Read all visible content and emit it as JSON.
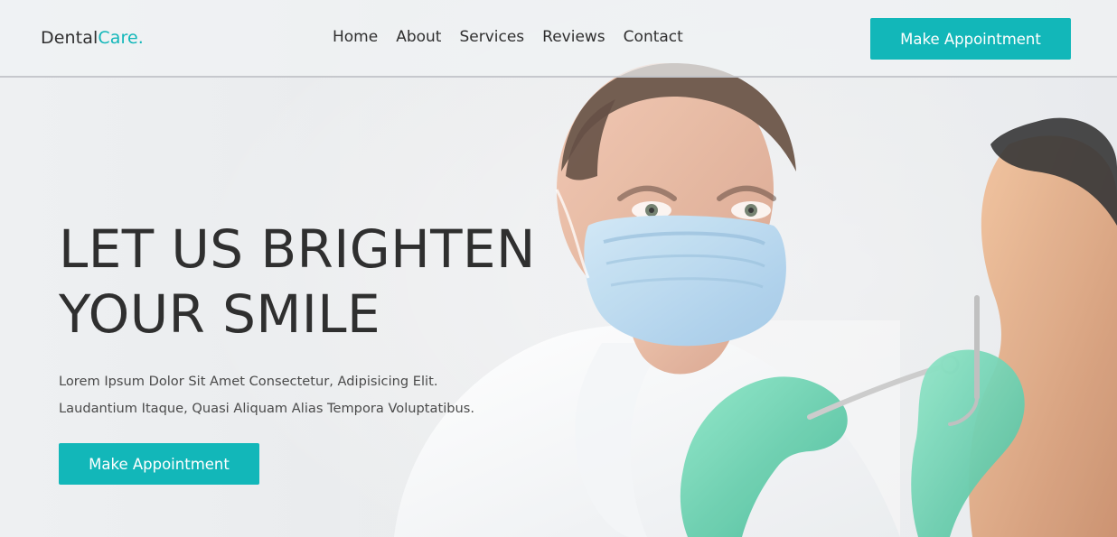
{
  "brand": {
    "name_primary": "Dental",
    "name_accent": "Care."
  },
  "header": {
    "nav": [
      {
        "label": "Home"
      },
      {
        "label": "About"
      },
      {
        "label": "Services"
      },
      {
        "label": "Reviews"
      },
      {
        "label": "Contact"
      }
    ],
    "cta_label": "Make Appointment"
  },
  "hero": {
    "headline_line1": "LET US BRIGHTEN",
    "headline_line2": "YOUR SMILE",
    "subtext_line1": "Lorem Ipsum Dolor Sit Amet Consectetur, Adipisicing Elit.",
    "subtext_line2": "Laudantium Itaque, Quasi Aliquam Alias Tempora Voluptatibus.",
    "cta_label": "Make Appointment"
  },
  "colors": {
    "accent": "#12b7b9",
    "text_dark": "#2f2f2f",
    "text_muted": "#4a4a4a",
    "header_bg": "#f0f2f4"
  },
  "imagery": {
    "hero_photo": "dentist-with-patient-photo",
    "icons": []
  }
}
